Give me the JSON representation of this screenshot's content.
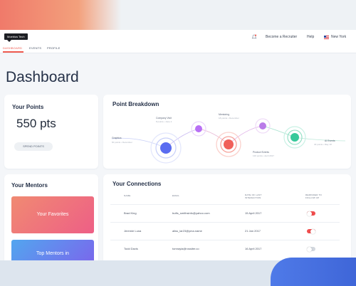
{
  "header": {
    "logo_text": "Moebius Tech",
    "become_recruiter": "Become a Recruiter",
    "help": "Help",
    "location": "New York",
    "bell_icon": "bell-icon",
    "flag_icon": "us-flag-icon"
  },
  "tabs": [
    {
      "label": "DASHBOARD",
      "active": true
    },
    {
      "label": "EVENTS",
      "active": false
    },
    {
      "label": "PROFILE",
      "active": false
    }
  ],
  "page": {
    "title": "Dashboard"
  },
  "points": {
    "title": "Your Points",
    "value": "550 pts",
    "spend_button": "SPEND POINTS"
  },
  "breakdown": {
    "title": "Point Breakdown",
    "nodes": [
      {
        "label": "Graphics",
        "sub": "60 points • December",
        "color": "#5a6cf0"
      },
      {
        "label": "Company Visit",
        "sub": "8 points • June 2",
        "color": "#b86ff5"
      },
      {
        "label": "Mentoring",
        "sub": "18 points • December",
        "color": "#b97be8"
      },
      {
        "label": "Product Events",
        "sub": "120 points • April 2017",
        "color": "#f0605a"
      },
      {
        "label": "AI Events",
        "sub": "40 points • May 18",
        "color": "#36c99a"
      }
    ]
  },
  "mentors": {
    "title": "Your Mentors",
    "tiles": [
      {
        "label": "Your Favorites"
      },
      {
        "label": "Top Mentors in"
      }
    ]
  },
  "connections": {
    "title": "Your Connections",
    "columns": [
      "NAME",
      "EMAIL",
      "DATE OF LAST INTERACTION",
      "REMINDER TO FOLLOW UP"
    ],
    "rows": [
      {
        "name": "Brad King",
        "email": "bufts_smithsinfo@yahoo.com",
        "date": "15 April 2017",
        "reminder": true
      },
      {
        "name": "Jeremie Luna",
        "email": "aliss_lar23@yma.name",
        "date": "21 Jan 2017",
        "reminder": true
      },
      {
        "name": "Todd Davis",
        "email": "tomrayia@rossiter.co",
        "date": "16 April 2017",
        "reminder": false
      }
    ]
  },
  "colors": {
    "accent": "#ef5a4f",
    "toggle_on": "#f04d4d",
    "toggle_off": "#d3d8df"
  }
}
